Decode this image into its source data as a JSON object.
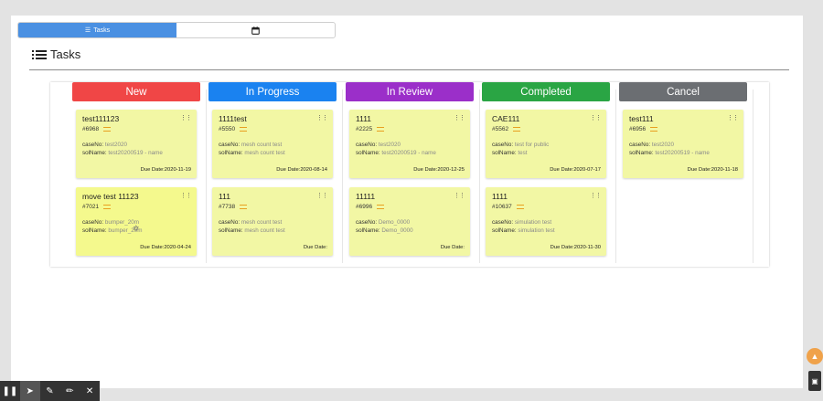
{
  "view_toggle": {
    "tasks_label": "Tasks"
  },
  "page_title": "Tasks",
  "columns": [
    {
      "title": "New",
      "color": "#f04646",
      "cards": [
        {
          "title": "test111123",
          "id": "#6968",
          "case_label": "caseNo:",
          "case": "test2020",
          "sol_label": "solName:",
          "sol": "test20200519 - name",
          "due": "Due Date:2020-11-19"
        },
        {
          "title": "move test 11123",
          "id": "#7021",
          "case_label": "caseNo:",
          "case": "bumper_20m",
          "sol_label": "solName:",
          "sol": "bumper_20m",
          "due": "Due Date:2020-04-24"
        }
      ]
    },
    {
      "title": "In Progress",
      "color": "#1a82f0",
      "cards": [
        {
          "title": "1111test",
          "id": "#5550",
          "case_label": "caseNo:",
          "case": "mesh count test",
          "sol_label": "solName:",
          "sol": "mesh count test",
          "due": "Due Date:2020-08-14"
        },
        {
          "title": "111",
          "id": "#7738",
          "case_label": "caseNo:",
          "case": "mesh count test",
          "sol_label": "solName:",
          "sol": "mesh count test",
          "due": "Due Date:"
        }
      ]
    },
    {
      "title": "In Review",
      "color": "#9b2fc9",
      "cards": [
        {
          "title": "1111",
          "id": "#2225",
          "case_label": "caseNo:",
          "case": "test2020",
          "sol_label": "solName:",
          "sol": "test20200519 - name",
          "due": "Due Date:2020-12-25"
        },
        {
          "title": "11111",
          "id": "#6996",
          "case_label": "caseNo:",
          "case": "Demo_0000",
          "sol_label": "solName:",
          "sol": "Demo_0000",
          "due": "Due Date:"
        }
      ]
    },
    {
      "title": "Completed",
      "color": "#2aa544",
      "cards": [
        {
          "title": "CAE111",
          "id": "#5562",
          "case_label": "caseNo:",
          "case": "test for public",
          "sol_label": "solName:",
          "sol": "test",
          "due": "Due Date:2020-07-17"
        },
        {
          "title": "1111",
          "id": "#10637",
          "case_label": "caseNo:",
          "case": "simulation test",
          "sol_label": "solName:",
          "sol": "simulation test",
          "due": "Due Date:2020-11-30"
        }
      ]
    },
    {
      "title": "Cancel",
      "color": "#6b6e72",
      "cards": [
        {
          "title": "test111",
          "id": "#6956",
          "case_label": "caseNo:",
          "case": "test2020",
          "sol_label": "solName:",
          "sol": "test20200519 - name",
          "due": "Due Date:2020-11-18"
        }
      ]
    }
  ]
}
